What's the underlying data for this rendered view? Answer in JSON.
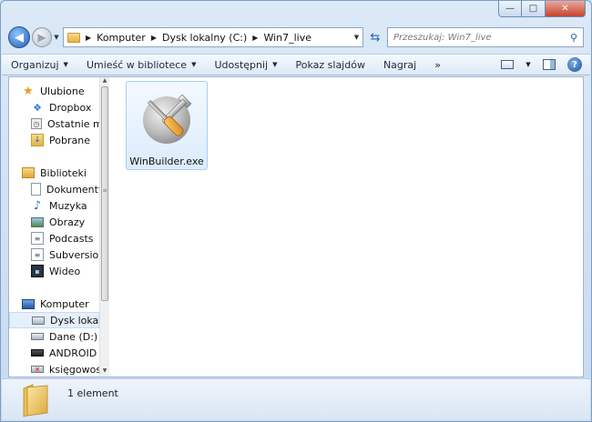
{
  "window": {
    "caption_min": "—",
    "caption_max": "□",
    "caption_close": "✕"
  },
  "address": {
    "breadcrumbs": [
      "Komputer",
      "Dysk lokalny (C:)",
      "Win7_live"
    ]
  },
  "search": {
    "placeholder": "Przeszukaj: Win7_live"
  },
  "toolbar": {
    "organize": "Organizuj",
    "include_library": "Umieść w bibliotece",
    "share": "Udostępnij",
    "slideshow": "Pokaz slajdów",
    "burn": "Nagraj",
    "more": "»"
  },
  "nav": {
    "favorites_label": "Ulubione",
    "favorites": [
      {
        "label": "Dropbox",
        "icon": "dropbox-icon"
      },
      {
        "label": "Ostatnie mi",
        "icon": "recent-places-icon"
      },
      {
        "label": "Pobrane",
        "icon": "downloads-icon"
      }
    ],
    "libraries_label": "Biblioteki",
    "libraries": [
      {
        "label": "Dokumenty",
        "icon": "documents-icon"
      },
      {
        "label": "Muzyka",
        "icon": "music-icon"
      },
      {
        "label": "Obrazy",
        "icon": "pictures-icon"
      },
      {
        "label": "Podcasts",
        "icon": "podcasts-icon"
      },
      {
        "label": "Subversion",
        "icon": "subversion-icon"
      },
      {
        "label": "Wideo",
        "icon": "videos-icon"
      }
    ],
    "computer_label": "Komputer",
    "drives": [
      {
        "label": "Dysk lokaln",
        "icon": "local-disk-icon",
        "selected": true
      },
      {
        "label": "Dane (D:)",
        "icon": "drive-icon",
        "selected": false
      },
      {
        "label": "ANDROID (I",
        "icon": "removable-drive-icon",
        "selected": false
      },
      {
        "label": "księgowosc",
        "icon": "network-drive-disconnected-icon",
        "selected": false
      }
    ]
  },
  "files": [
    {
      "name": "WinBuilder.exe",
      "icon": "winbuilder-tools-icon",
      "selected": true
    }
  ],
  "status": {
    "count": "1 element"
  },
  "colors": {
    "selection_bg": "#dcecfc",
    "selection_border": "#a8cdf1",
    "frame": "#c6daf0",
    "close_button": "#c7432c"
  }
}
